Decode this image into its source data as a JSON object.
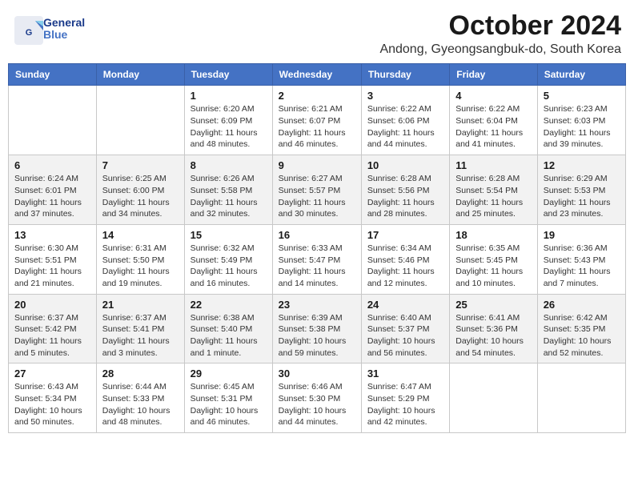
{
  "logo": {
    "text_general": "General",
    "text_blue": "Blue"
  },
  "title": "October 2024",
  "location": "Andong, Gyeongsangbuk-do, South Korea",
  "days_of_week": [
    "Sunday",
    "Monday",
    "Tuesday",
    "Wednesday",
    "Thursday",
    "Friday",
    "Saturday"
  ],
  "weeks": [
    [
      {
        "day": "",
        "sunrise": "",
        "sunset": "",
        "daylight": ""
      },
      {
        "day": "",
        "sunrise": "",
        "sunset": "",
        "daylight": ""
      },
      {
        "day": "1",
        "sunrise": "Sunrise: 6:20 AM",
        "sunset": "Sunset: 6:09 PM",
        "daylight": "Daylight: 11 hours and 48 minutes."
      },
      {
        "day": "2",
        "sunrise": "Sunrise: 6:21 AM",
        "sunset": "Sunset: 6:07 PM",
        "daylight": "Daylight: 11 hours and 46 minutes."
      },
      {
        "day": "3",
        "sunrise": "Sunrise: 6:22 AM",
        "sunset": "Sunset: 6:06 PM",
        "daylight": "Daylight: 11 hours and 44 minutes."
      },
      {
        "day": "4",
        "sunrise": "Sunrise: 6:22 AM",
        "sunset": "Sunset: 6:04 PM",
        "daylight": "Daylight: 11 hours and 41 minutes."
      },
      {
        "day": "5",
        "sunrise": "Sunrise: 6:23 AM",
        "sunset": "Sunset: 6:03 PM",
        "daylight": "Daylight: 11 hours and 39 minutes."
      }
    ],
    [
      {
        "day": "6",
        "sunrise": "Sunrise: 6:24 AM",
        "sunset": "Sunset: 6:01 PM",
        "daylight": "Daylight: 11 hours and 37 minutes."
      },
      {
        "day": "7",
        "sunrise": "Sunrise: 6:25 AM",
        "sunset": "Sunset: 6:00 PM",
        "daylight": "Daylight: 11 hours and 34 minutes."
      },
      {
        "day": "8",
        "sunrise": "Sunrise: 6:26 AM",
        "sunset": "Sunset: 5:58 PM",
        "daylight": "Daylight: 11 hours and 32 minutes."
      },
      {
        "day": "9",
        "sunrise": "Sunrise: 6:27 AM",
        "sunset": "Sunset: 5:57 PM",
        "daylight": "Daylight: 11 hours and 30 minutes."
      },
      {
        "day": "10",
        "sunrise": "Sunrise: 6:28 AM",
        "sunset": "Sunset: 5:56 PM",
        "daylight": "Daylight: 11 hours and 28 minutes."
      },
      {
        "day": "11",
        "sunrise": "Sunrise: 6:28 AM",
        "sunset": "Sunset: 5:54 PM",
        "daylight": "Daylight: 11 hours and 25 minutes."
      },
      {
        "day": "12",
        "sunrise": "Sunrise: 6:29 AM",
        "sunset": "Sunset: 5:53 PM",
        "daylight": "Daylight: 11 hours and 23 minutes."
      }
    ],
    [
      {
        "day": "13",
        "sunrise": "Sunrise: 6:30 AM",
        "sunset": "Sunset: 5:51 PM",
        "daylight": "Daylight: 11 hours and 21 minutes."
      },
      {
        "day": "14",
        "sunrise": "Sunrise: 6:31 AM",
        "sunset": "Sunset: 5:50 PM",
        "daylight": "Daylight: 11 hours and 19 minutes."
      },
      {
        "day": "15",
        "sunrise": "Sunrise: 6:32 AM",
        "sunset": "Sunset: 5:49 PM",
        "daylight": "Daylight: 11 hours and 16 minutes."
      },
      {
        "day": "16",
        "sunrise": "Sunrise: 6:33 AM",
        "sunset": "Sunset: 5:47 PM",
        "daylight": "Daylight: 11 hours and 14 minutes."
      },
      {
        "day": "17",
        "sunrise": "Sunrise: 6:34 AM",
        "sunset": "Sunset: 5:46 PM",
        "daylight": "Daylight: 11 hours and 12 minutes."
      },
      {
        "day": "18",
        "sunrise": "Sunrise: 6:35 AM",
        "sunset": "Sunset: 5:45 PM",
        "daylight": "Daylight: 11 hours and 10 minutes."
      },
      {
        "day": "19",
        "sunrise": "Sunrise: 6:36 AM",
        "sunset": "Sunset: 5:43 PM",
        "daylight": "Daylight: 11 hours and 7 minutes."
      }
    ],
    [
      {
        "day": "20",
        "sunrise": "Sunrise: 6:37 AM",
        "sunset": "Sunset: 5:42 PM",
        "daylight": "Daylight: 11 hours and 5 minutes."
      },
      {
        "day": "21",
        "sunrise": "Sunrise: 6:37 AM",
        "sunset": "Sunset: 5:41 PM",
        "daylight": "Daylight: 11 hours and 3 minutes."
      },
      {
        "day": "22",
        "sunrise": "Sunrise: 6:38 AM",
        "sunset": "Sunset: 5:40 PM",
        "daylight": "Daylight: 11 hours and 1 minute."
      },
      {
        "day": "23",
        "sunrise": "Sunrise: 6:39 AM",
        "sunset": "Sunset: 5:38 PM",
        "daylight": "Daylight: 10 hours and 59 minutes."
      },
      {
        "day": "24",
        "sunrise": "Sunrise: 6:40 AM",
        "sunset": "Sunset: 5:37 PM",
        "daylight": "Daylight: 10 hours and 56 minutes."
      },
      {
        "day": "25",
        "sunrise": "Sunrise: 6:41 AM",
        "sunset": "Sunset: 5:36 PM",
        "daylight": "Daylight: 10 hours and 54 minutes."
      },
      {
        "day": "26",
        "sunrise": "Sunrise: 6:42 AM",
        "sunset": "Sunset: 5:35 PM",
        "daylight": "Daylight: 10 hours and 52 minutes."
      }
    ],
    [
      {
        "day": "27",
        "sunrise": "Sunrise: 6:43 AM",
        "sunset": "Sunset: 5:34 PM",
        "daylight": "Daylight: 10 hours and 50 minutes."
      },
      {
        "day": "28",
        "sunrise": "Sunrise: 6:44 AM",
        "sunset": "Sunset: 5:33 PM",
        "daylight": "Daylight: 10 hours and 48 minutes."
      },
      {
        "day": "29",
        "sunrise": "Sunrise: 6:45 AM",
        "sunset": "Sunset: 5:31 PM",
        "daylight": "Daylight: 10 hours and 46 minutes."
      },
      {
        "day": "30",
        "sunrise": "Sunrise: 6:46 AM",
        "sunset": "Sunset: 5:30 PM",
        "daylight": "Daylight: 10 hours and 44 minutes."
      },
      {
        "day": "31",
        "sunrise": "Sunrise: 6:47 AM",
        "sunset": "Sunset: 5:29 PM",
        "daylight": "Daylight: 10 hours and 42 minutes."
      },
      {
        "day": "",
        "sunrise": "",
        "sunset": "",
        "daylight": ""
      },
      {
        "day": "",
        "sunrise": "",
        "sunset": "",
        "daylight": ""
      }
    ]
  ]
}
